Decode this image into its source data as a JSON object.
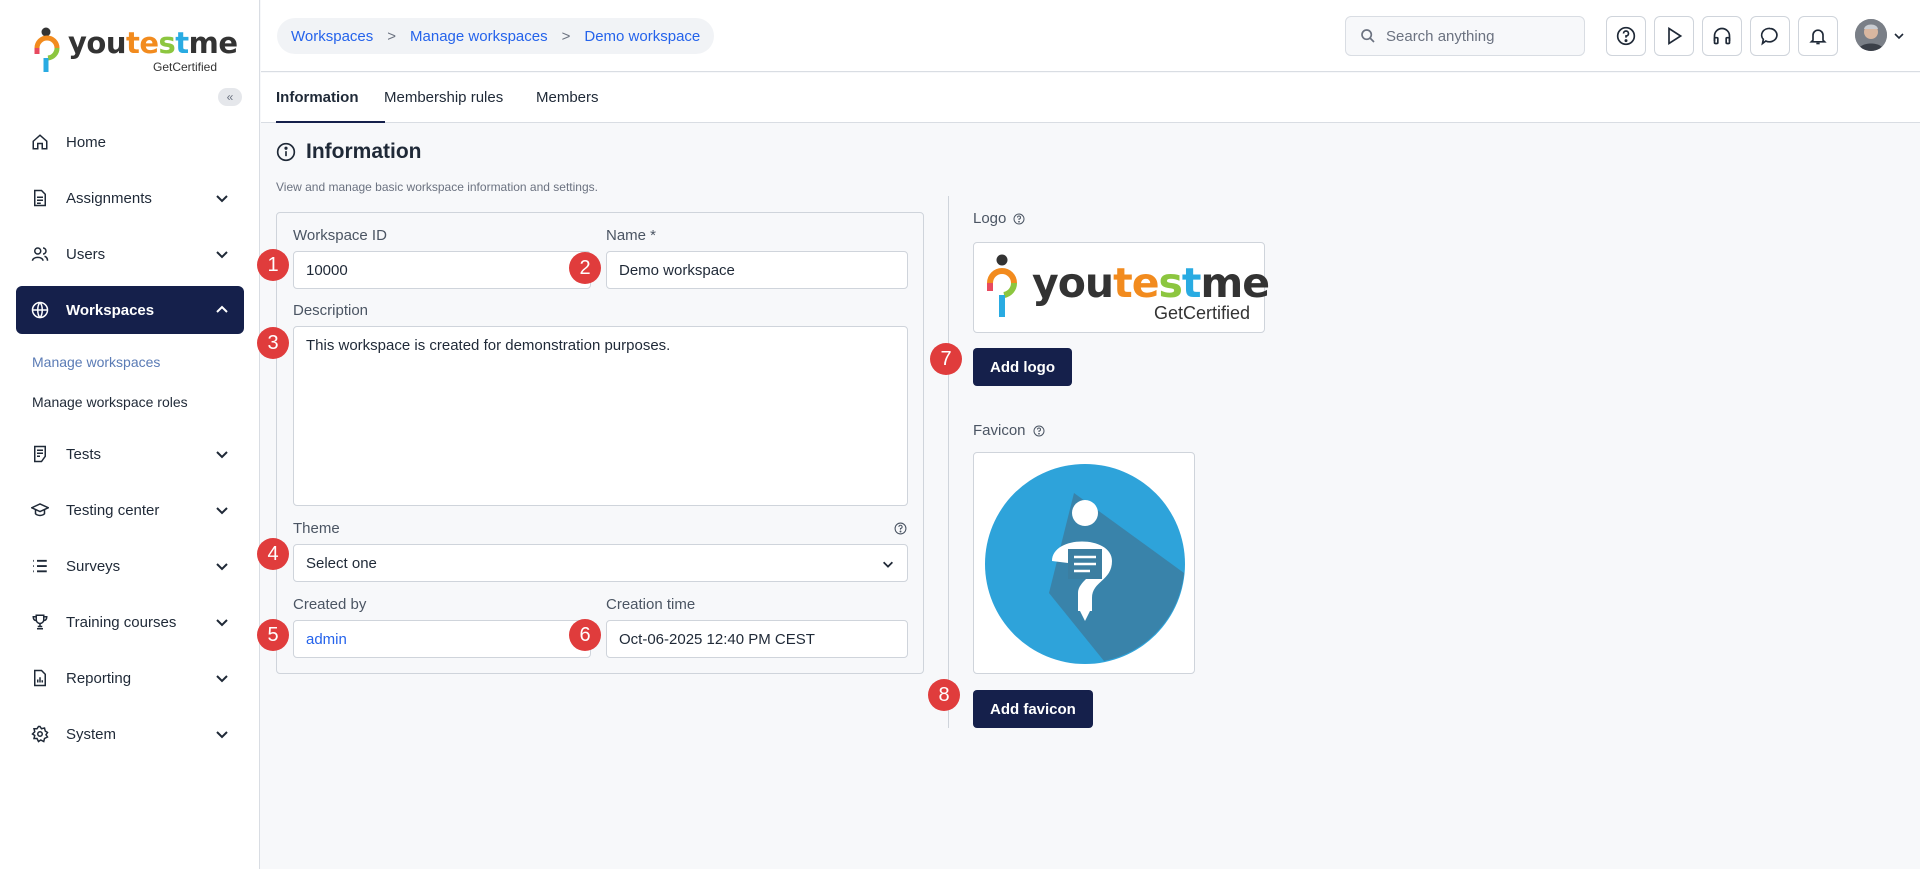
{
  "brand": {
    "name_you": "you",
    "name_te": "te",
    "name_s": "s",
    "name_t": "t",
    "name_me": "me",
    "tagline": "GetCertified",
    "collapse_glyph": "«"
  },
  "sidebar": {
    "items": [
      {
        "label": "Home",
        "icon": "home-icon"
      },
      {
        "label": "Assignments",
        "icon": "document-icon"
      },
      {
        "label": "Users",
        "icon": "users-icon"
      },
      {
        "label": "Workspaces",
        "icon": "globe-icon"
      },
      {
        "label": "Tests",
        "icon": "test-icon"
      },
      {
        "label": "Testing center",
        "icon": "graduation-cap-icon"
      },
      {
        "label": "Surveys",
        "icon": "list-icon"
      },
      {
        "label": "Training courses",
        "icon": "trophy-icon"
      },
      {
        "label": "Reporting",
        "icon": "report-icon"
      },
      {
        "label": "System",
        "icon": "gear-icon"
      }
    ],
    "subitems": [
      {
        "label": "Manage workspaces"
      },
      {
        "label": "Manage workspace roles"
      }
    ]
  },
  "breadcrumb": {
    "items": [
      "Workspaces",
      "Manage workspaces",
      "Demo workspace"
    ],
    "separator": ">"
  },
  "search": {
    "placeholder": "Search anything"
  },
  "tabs": [
    "Information",
    "Membership rules",
    "Members"
  ],
  "info": {
    "title": "Information",
    "description": "View and manage basic workspace information and settings.",
    "workspace_id_label": "Workspace ID",
    "workspace_id_value": "10000",
    "name_label": "Name *",
    "name_value": "Demo workspace",
    "description_label": "Description",
    "description_value": "This workspace is created for demonstration purposes.",
    "theme_label": "Theme",
    "theme_value": "Select one",
    "created_by_label": "Created by",
    "created_by_value": "admin",
    "creation_time_label": "Creation time",
    "creation_time_value": "Oct-06-2025 12:40 PM CEST"
  },
  "media": {
    "logo_label": "Logo",
    "add_logo": "Add logo",
    "favicon_label": "Favicon",
    "add_favicon": "Add favicon"
  },
  "badges": [
    "1",
    "2",
    "3",
    "4",
    "5",
    "6",
    "7",
    "8"
  ],
  "colors": {
    "navy": "#15204b",
    "link": "#2563eb",
    "badge": "#e03c3c",
    "favicon_blue": "#2ea3da"
  }
}
